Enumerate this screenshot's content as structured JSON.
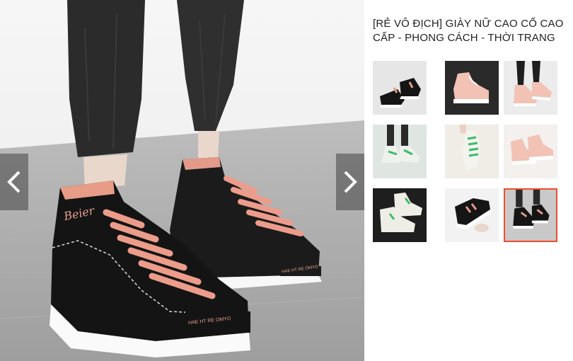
{
  "product": {
    "title": "[RẺ VÔ ĐỊCH] GIÀY NỮ CAO CỔ CAO CẤP - PHONG CÁCH - THỜI TRANG",
    "main_image": {
      "brand_text": "Beier",
      "strap_text": "HAE HT RE OMYO"
    }
  },
  "gallery": {
    "prev_icon": "chevron-left-icon",
    "next_icon": "chevron-right-icon",
    "selected_index": 8,
    "accent_color": "#ee4d2d",
    "thumbnails": [
      {
        "name": "thumb-black-pink-pair",
        "bg": "#e6e6e6"
      },
      {
        "name": "thumb-pink-single",
        "bg": "#2a2a2a"
      },
      {
        "name": "thumb-pink-worn",
        "bg": "#ececec"
      },
      {
        "name": "thumb-green-pair",
        "bg": "#dfe6e1"
      },
      {
        "name": "thumb-green-worn",
        "bg": "#f0ece6"
      },
      {
        "name": "thumb-pink-pair",
        "bg": "#f3f0ee"
      },
      {
        "name": "thumb-white-green-dark",
        "bg": "#1e1e1e"
      },
      {
        "name": "thumb-black-hand",
        "bg": "#f2f2f2"
      },
      {
        "name": "thumb-black-worn",
        "bg": "#c9c9c9"
      }
    ]
  }
}
